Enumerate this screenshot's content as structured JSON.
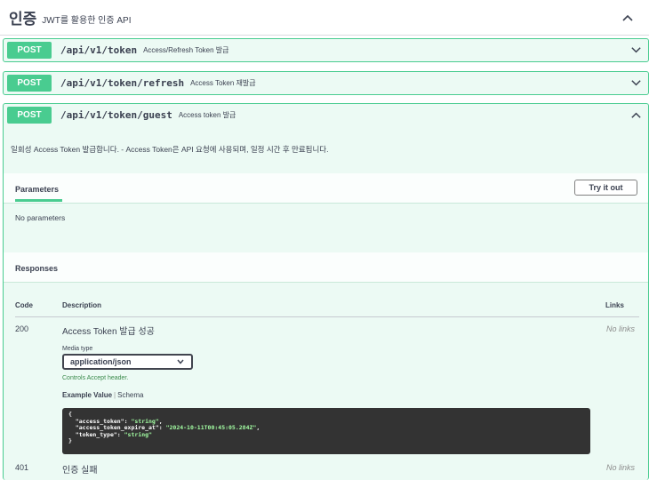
{
  "tag": {
    "name": "인증",
    "description": "JWT를 활용한 인증 API"
  },
  "operations": [
    {
      "method": "POST",
      "path": "/api/v1/token",
      "summary": "Access/Refresh Token 발급"
    },
    {
      "method": "POST",
      "path": "/api/v1/token/refresh",
      "summary": "Access Token 재발급"
    },
    {
      "method": "POST",
      "path": "/api/v1/token/guest",
      "summary": "Access token 발급"
    }
  ],
  "expanded": {
    "description": "일회성 Access Token 발급합니다. - Access Token은 API 요청에 사용되며, 일정 시간 후 만료됩니다.",
    "parameters_title": "Parameters",
    "try_button": "Try it out",
    "no_parameters": "No parameters",
    "responses_title": "Responses",
    "columns": {
      "code": "Code",
      "description": "Description",
      "links": "Links"
    },
    "responses": [
      {
        "code": "200",
        "description": "Access Token 발급 성공",
        "links": "No links"
      },
      {
        "code": "401",
        "description": "인증 실패",
        "links": "No links"
      }
    ],
    "media_type_label": "Media type",
    "media_type_value": "application/json",
    "controls_text": "Controls Accept header.",
    "example_tab": "Example Value",
    "schema_tab": "Schema",
    "example_json": {
      "open": "{",
      "l1_key": "\"access_token\"",
      "l1_val": "\"string\"",
      "l2_key": "\"access_token_expire_at\"",
      "l2_val": "\"2024-10-11T00:45:05.284Z\"",
      "l3_key": "\"token_type\"",
      "l3_val": "\"string\"",
      "close": "}"
    }
  },
  "colors": {
    "post": "#49cc90",
    "code_bg": "#333333",
    "string": "#a2fca2"
  },
  "icons": {
    "collapse": "chevron-up-icon",
    "expand": "chevron-down-icon"
  }
}
